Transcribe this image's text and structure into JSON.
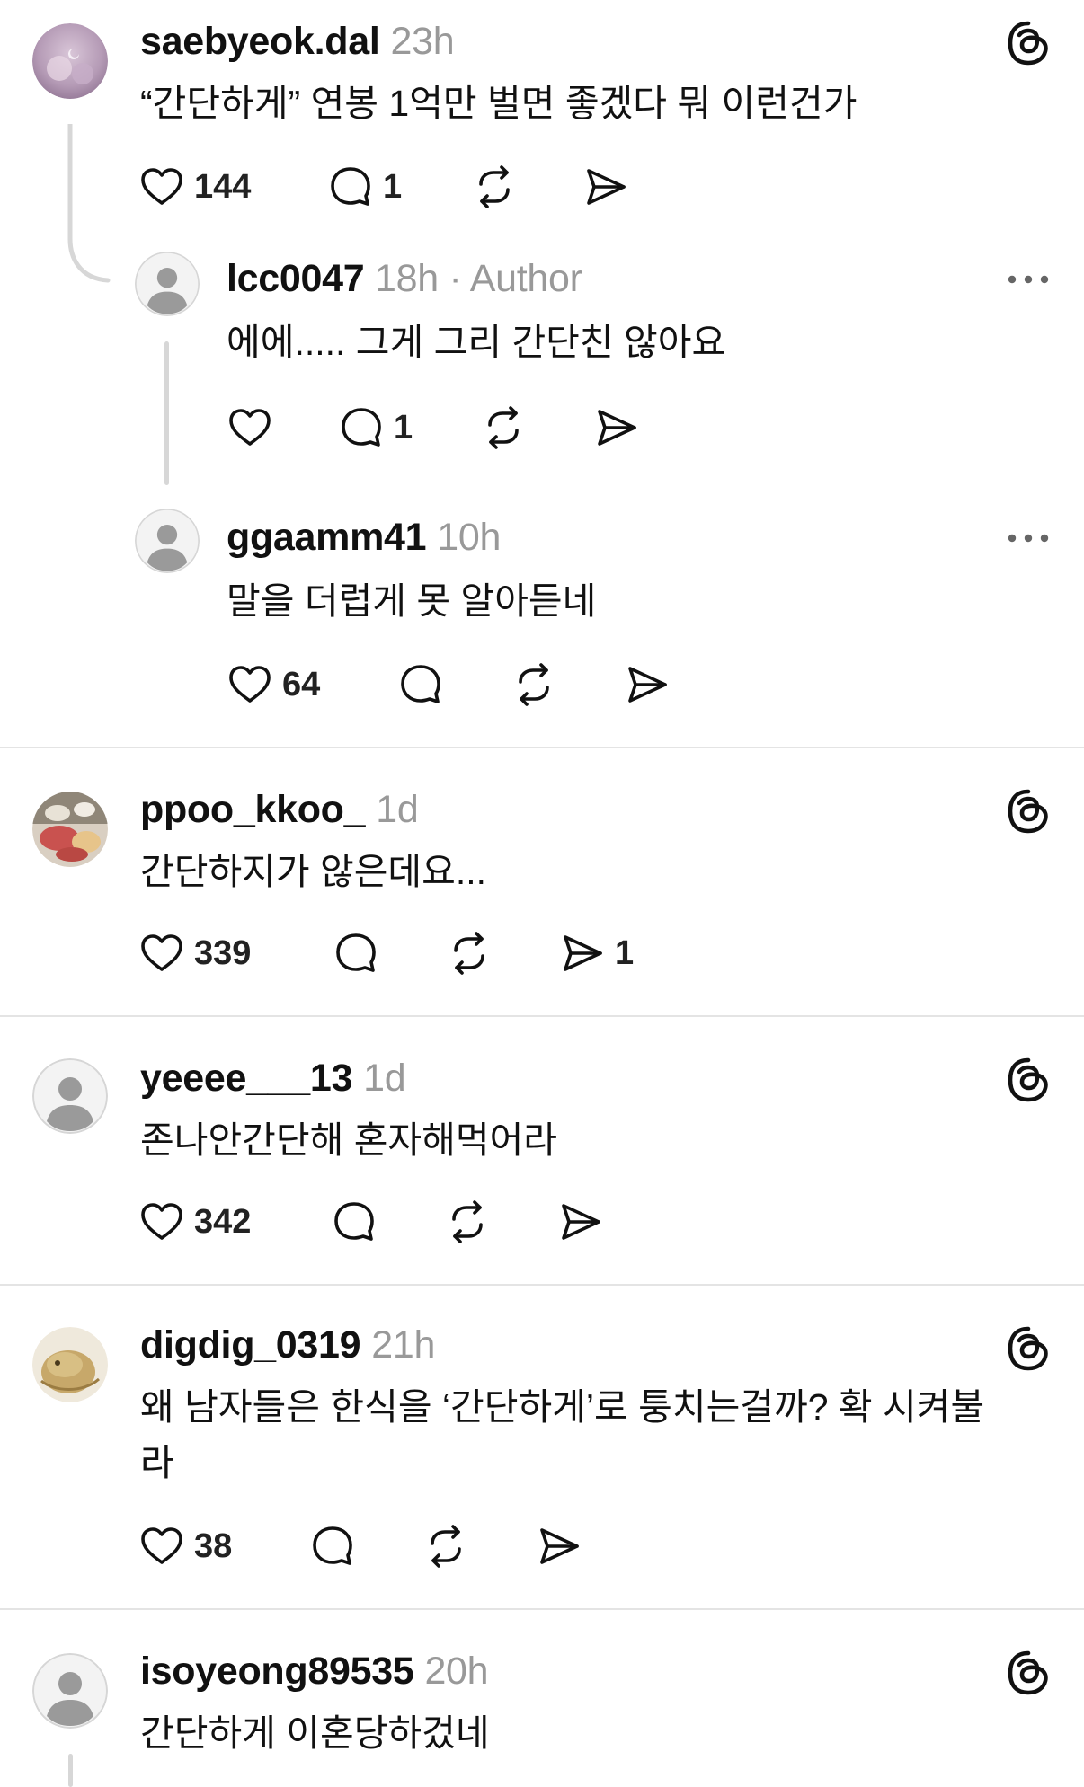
{
  "colors": {
    "text": "#111111",
    "muted": "#999999",
    "divider": "#e4e4e4",
    "thread_line": "#d7d7d7"
  },
  "icons": [
    "heart-icon",
    "comment-icon",
    "repost-icon",
    "share-icon",
    "threads-logo-icon",
    "more-options-icon"
  ],
  "thread_1": {
    "post": {
      "username": "saebyeok.dal",
      "time": "23h",
      "text": "“간단하게” 연봉 1억만 벌면 좋겠다 뭐 이런건가",
      "likes": "144",
      "comments": "1"
    },
    "reply_1": {
      "username": "lcc0047",
      "meta": "18h · Author",
      "text": "에에..... 그게 그리 간단친 않아요",
      "comments": "1"
    },
    "reply_2": {
      "username": "ggaamm41",
      "time": "10h",
      "text": "말을 더럽게 못 알아듣네",
      "likes": "64"
    }
  },
  "post_2": {
    "username": "ppoo_kkoo_",
    "time": "1d",
    "text": "간단하지가 않은데요...",
    "likes": "339",
    "shares": "1"
  },
  "post_3": {
    "username": "yeeee___13",
    "time": "1d",
    "text": "존나안간단해 혼자해먹어라",
    "likes": "342"
  },
  "post_4": {
    "username": "digdig_0319",
    "time": "21h",
    "text_line1": "왜 남자들은 한식을 ‘간단하게’로 퉁치는걸까? 확 시켜불",
    "text_line2": "라",
    "likes": "38"
  },
  "post_5": {
    "username": "isoyeong89535",
    "time": "20h",
    "text": "간단하게 이혼당하겄네"
  }
}
